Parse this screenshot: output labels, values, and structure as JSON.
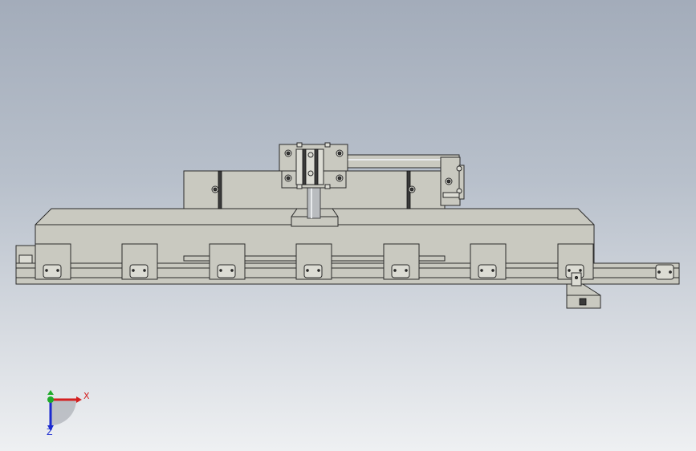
{
  "triad": {
    "x_label": "X",
    "z_label": "Z",
    "colors": {
      "x": "#d42020",
      "y": "#1faa2a",
      "z": "#1a2ad0"
    }
  },
  "colors": {
    "background_top": "#a3acba",
    "background_bottom": "#eef0f2",
    "part_fill": "#c9c9c0"
  }
}
